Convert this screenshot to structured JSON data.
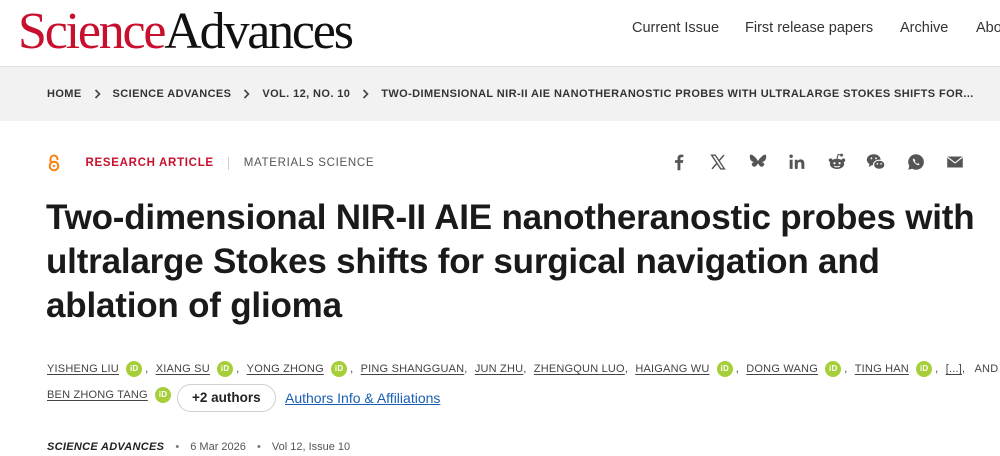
{
  "header": {
    "logo_science": "Science",
    "logo_advances": "Advances",
    "nav": [
      "Current Issue",
      "First release papers",
      "Archive",
      "About"
    ]
  },
  "breadcrumb": [
    "HOME",
    "SCIENCE ADVANCES",
    "VOL. 12, NO. 10",
    "TWO-DIMENSIONAL NIR-II AIE NANOTHERANOSTIC PROBES WITH ULTRALARGE STOKES SHIFTS FOR..."
  ],
  "article": {
    "type": "RESEARCH ARTICLE",
    "subject": "MATERIALS SCIENCE",
    "title": "Two-dimensional NIR-II AIE nanotheranostic probes with ultralarge Stokes shifts for surgical navigation and ablation of glioma",
    "share_icons": [
      "facebook-icon",
      "x-icon",
      "bluesky-icon",
      "linkedin-icon",
      "reddit-icon",
      "wechat-icon",
      "whatsapp-icon",
      "email-icon"
    ],
    "authors": {
      "names": [
        "YISHENG LIU",
        "XIANG SU",
        "YONG ZHONG",
        "PING SHANGGUAN",
        "JUN ZHU",
        "ZHENGQUN LUO",
        "HAIGANG WU",
        "DONG WANG",
        "TING HAN",
        "BEN ZHONG TANG"
      ],
      "orcid_label": "iD",
      "ellipsis": "[...]",
      "and": "AND",
      "more_button": "+2 authors",
      "affiliations_link": "Authors Info & Affiliations"
    },
    "journal": "SCIENCE ADVANCES",
    "date": "6 Mar 2026",
    "issue": "Vol 12, Issue 10",
    "separator": "•"
  },
  "colors": {
    "brand_red": "#c8102e",
    "orcid_green": "#a6ce39",
    "link_blue": "#1a5fb4",
    "open_access_orange": "#f68212"
  }
}
